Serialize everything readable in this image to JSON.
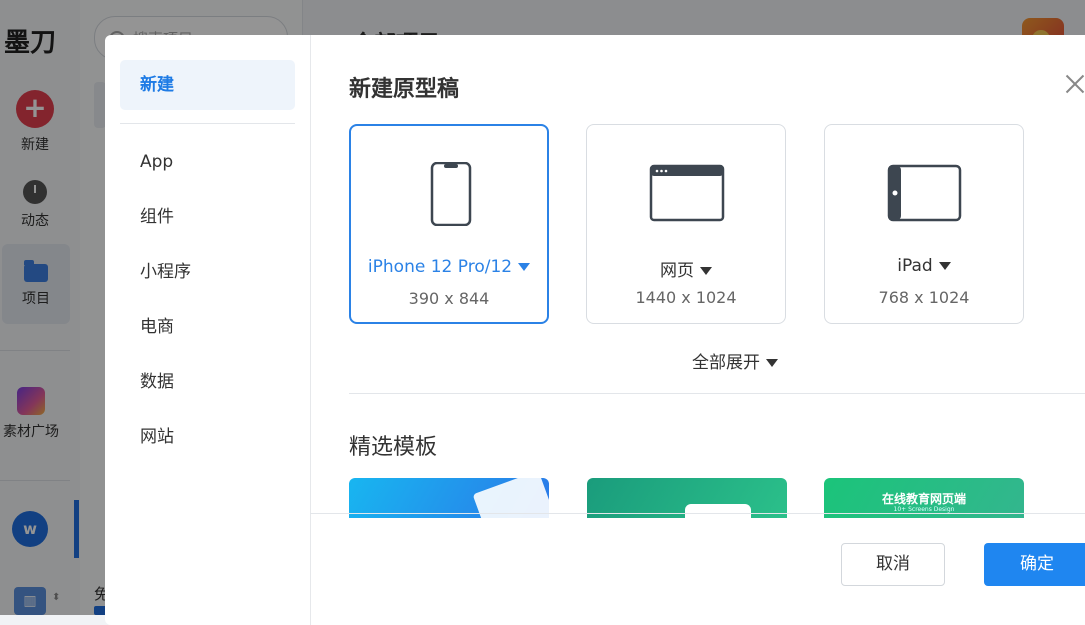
{
  "app": {
    "logo": "墨刀",
    "rail": {
      "new_label": "新建",
      "activity_label": "动态",
      "projects_label": "项目",
      "materials_label": "素材广场"
    },
    "avatar_initial": "w",
    "search_placeholder": "搜索项目",
    "main_title": "全部项目",
    "bottom_peek": "免"
  },
  "modal": {
    "side": {
      "new_label": "新建",
      "items": [
        "App",
        "组件",
        "小程序",
        "电商",
        "数据",
        "网站"
      ]
    },
    "title": "新建原型稿",
    "devices": [
      {
        "name": "iPhone 12 Pro/12",
        "size": "390 x 844",
        "icon": "phone-icon",
        "selected": true
      },
      {
        "name": "网页",
        "size": "1440 x 1024",
        "icon": "browser-window-icon",
        "selected": false
      },
      {
        "name": "iPad",
        "size": "768 x 1024",
        "icon": "tablet-icon",
        "selected": false
      }
    ],
    "expand_all": "全部展开",
    "templates_title": "精选模板",
    "templates": [
      {
        "title": ""
      },
      {
        "title": ""
      },
      {
        "title": "在线教育网页端",
        "subtitle": "10+ Screens Design"
      }
    ],
    "cancel": "取消",
    "confirm": "确定"
  },
  "colors": {
    "accent": "#1f86f0",
    "selected_border": "#2b82e6",
    "brand_red": "#e23f4e"
  }
}
